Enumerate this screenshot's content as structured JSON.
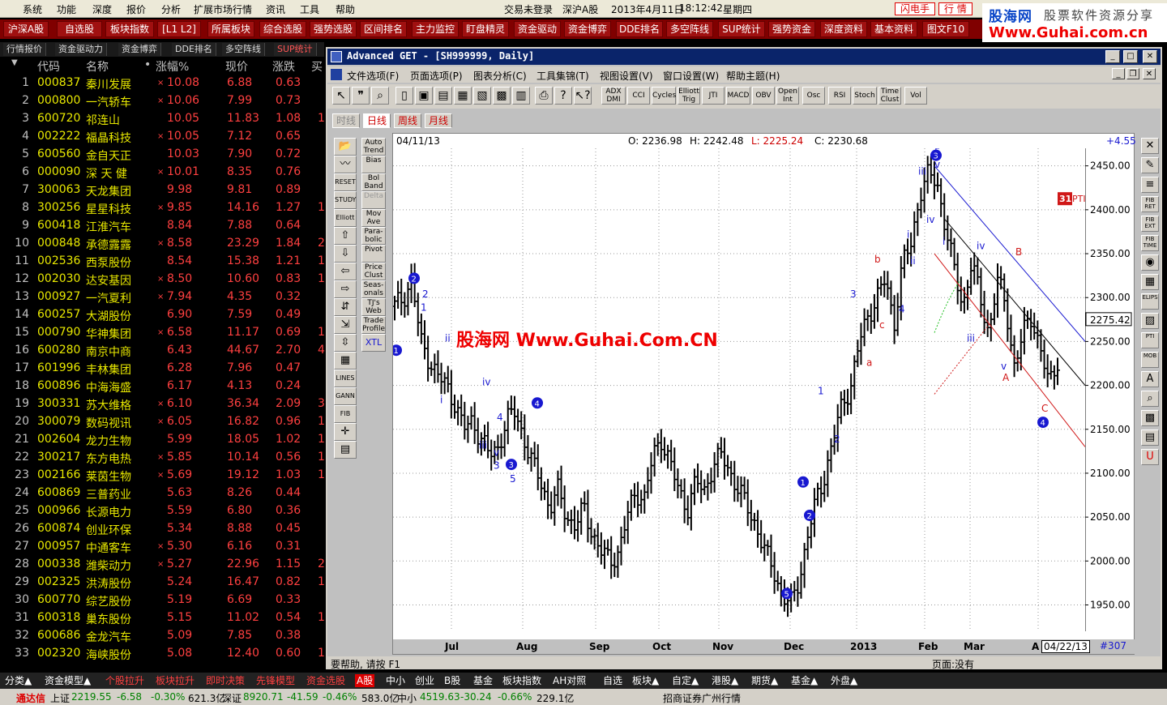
{
  "menu": {
    "items": [
      "系统",
      "功能",
      "深度",
      "报价",
      "分析",
      "扩展市场行情",
      "资讯",
      "工具",
      "帮助"
    ],
    "status": "交易未登录",
    "market": "深沪A股",
    "datetime": "2013年4月11日",
    "time": "18:12:42",
    "weekday": "星期四",
    "flash_btn": "闪电手",
    "quote_btn": "行  情"
  },
  "logo": {
    "line1": "股海网",
    "line1b": "股票软件资源分享",
    "line2": "Www.Guhai.com.cn"
  },
  "toolbar": [
    "沪深A股",
    "自选股",
    "板块指数",
    "[L1 L2]",
    "所属板块",
    "综合选股",
    "强势选股",
    "区间排名",
    "主力监控",
    "盯盘精灵",
    "资金驱动",
    "资金博弈",
    "DDE排名",
    "多空阵线",
    "SUP统计",
    "强势资金",
    "深度资料",
    "基本资料",
    "图文F10"
  ],
  "subtabs": [
    "行情报价",
    "资金驱动力",
    "资金博弈",
    "DDE排名",
    "多空阵线",
    "SUP统计"
  ],
  "quote": {
    "headers": [
      "代码",
      "名称",
      "•",
      "涨幅%",
      "现价",
      "涨跌",
      "买"
    ],
    "rows": [
      {
        "n": "1",
        "code": "000837",
        "name": "秦川发展",
        "mark": "×",
        "pct": "10.08",
        "price": "6.88",
        "chg": "0.63",
        "extra": ""
      },
      {
        "n": "2",
        "code": "000800",
        "name": "一汽轿车",
        "mark": "×",
        "pct": "10.06",
        "price": "7.99",
        "chg": "0.73",
        "extra": ""
      },
      {
        "n": "3",
        "code": "600720",
        "name": "祁连山",
        "mark": "",
        "pct": "10.05",
        "price": "11.83",
        "chg": "1.08",
        "extra": "1"
      },
      {
        "n": "4",
        "code": "002222",
        "name": "福晶科技",
        "mark": "×",
        "pct": "10.05",
        "price": "7.12",
        "chg": "0.65",
        "extra": ""
      },
      {
        "n": "5",
        "code": "600560",
        "name": "金自天正",
        "mark": "",
        "pct": "10.03",
        "price": "7.90",
        "chg": "0.72",
        "extra": ""
      },
      {
        "n": "6",
        "code": "000090",
        "name": "深 天 健",
        "mark": "×",
        "pct": "10.01",
        "price": "8.35",
        "chg": "0.76",
        "extra": ""
      },
      {
        "n": "7",
        "code": "300063",
        "name": "天龙集团",
        "mark": "",
        "pct": "9.98",
        "price": "9.81",
        "chg": "0.89",
        "extra": ""
      },
      {
        "n": "8",
        "code": "300256",
        "name": "星星科技",
        "mark": "×",
        "pct": "9.85",
        "price": "14.16",
        "chg": "1.27",
        "extra": "1"
      },
      {
        "n": "9",
        "code": "600418",
        "name": "江淮汽车",
        "mark": "",
        "pct": "8.84",
        "price": "7.88",
        "chg": "0.64",
        "extra": ""
      },
      {
        "n": "10",
        "code": "000848",
        "name": "承德露露",
        "mark": "×",
        "pct": "8.58",
        "price": "23.29",
        "chg": "1.84",
        "extra": "2"
      },
      {
        "n": "11",
        "code": "002536",
        "name": "西泵股份",
        "mark": "",
        "pct": "8.54",
        "price": "15.38",
        "chg": "1.21",
        "extra": "1"
      },
      {
        "n": "12",
        "code": "002030",
        "name": "达安基因",
        "mark": "×",
        "pct": "8.50",
        "price": "10.60",
        "chg": "0.83",
        "extra": "1"
      },
      {
        "n": "13",
        "code": "000927",
        "name": "一汽夏利",
        "mark": "×",
        "pct": "7.94",
        "price": "4.35",
        "chg": "0.32",
        "extra": ""
      },
      {
        "n": "14",
        "code": "600257",
        "name": "大湖股份",
        "mark": "",
        "pct": "6.90",
        "price": "7.59",
        "chg": "0.49",
        "extra": ""
      },
      {
        "n": "15",
        "code": "000790",
        "name": "华神集团",
        "mark": "×",
        "pct": "6.58",
        "price": "11.17",
        "chg": "0.69",
        "extra": "1"
      },
      {
        "n": "16",
        "code": "600280",
        "name": "南京中商",
        "mark": "",
        "pct": "6.43",
        "price": "44.67",
        "chg": "2.70",
        "extra": "4"
      },
      {
        "n": "17",
        "code": "601996",
        "name": "丰林集团",
        "mark": "",
        "pct": "6.28",
        "price": "7.96",
        "chg": "0.47",
        "extra": ""
      },
      {
        "n": "18",
        "code": "600896",
        "name": "中海海盛",
        "mark": "",
        "pct": "6.17",
        "price": "4.13",
        "chg": "0.24",
        "extra": ""
      },
      {
        "n": "19",
        "code": "300331",
        "name": "苏大维格",
        "mark": "×",
        "pct": "6.10",
        "price": "36.34",
        "chg": "2.09",
        "extra": "3"
      },
      {
        "n": "20",
        "code": "300079",
        "name": "数码视讯",
        "mark": "×",
        "pct": "6.05",
        "price": "16.82",
        "chg": "0.96",
        "extra": "1"
      },
      {
        "n": "21",
        "code": "002604",
        "name": "龙力生物",
        "mark": "",
        "pct": "5.99",
        "price": "18.05",
        "chg": "1.02",
        "extra": "1"
      },
      {
        "n": "22",
        "code": "300217",
        "name": "东方电热",
        "mark": "×",
        "pct": "5.85",
        "price": "10.14",
        "chg": "0.56",
        "extra": "1"
      },
      {
        "n": "23",
        "code": "002166",
        "name": "莱茵生物",
        "mark": "×",
        "pct": "5.69",
        "price": "19.12",
        "chg": "1.03",
        "extra": "1"
      },
      {
        "n": "24",
        "code": "600869",
        "name": "三普药业",
        "mark": "",
        "pct": "5.63",
        "price": "8.26",
        "chg": "0.44",
        "extra": ""
      },
      {
        "n": "25",
        "code": "000966",
        "name": "长源电力",
        "mark": "",
        "pct": "5.59",
        "price": "6.80",
        "chg": "0.36",
        "extra": ""
      },
      {
        "n": "26",
        "code": "600874",
        "name": "创业环保",
        "mark": "",
        "pct": "5.34",
        "price": "8.88",
        "chg": "0.45",
        "extra": ""
      },
      {
        "n": "27",
        "code": "000957",
        "name": "中通客车",
        "mark": "×",
        "pct": "5.30",
        "price": "6.16",
        "chg": "0.31",
        "extra": ""
      },
      {
        "n": "28",
        "code": "000338",
        "name": "潍柴动力",
        "mark": "×",
        "pct": "5.27",
        "price": "22.96",
        "chg": "1.15",
        "extra": "2"
      },
      {
        "n": "29",
        "code": "002325",
        "name": "洪涛股份",
        "mark": "",
        "pct": "5.24",
        "price": "16.47",
        "chg": "0.82",
        "extra": "1"
      },
      {
        "n": "30",
        "code": "600770",
        "name": "综艺股份",
        "mark": "",
        "pct": "5.19",
        "price": "6.69",
        "chg": "0.33",
        "extra": ""
      },
      {
        "n": "31",
        "code": "600318",
        "name": "巢东股份",
        "mark": "",
        "pct": "5.15",
        "price": "11.02",
        "chg": "0.54",
        "extra": "1"
      },
      {
        "n": "32",
        "code": "600686",
        "name": "金龙汽车",
        "mark": "",
        "pct": "5.09",
        "price": "7.85",
        "chg": "0.38",
        "extra": ""
      },
      {
        "n": "33",
        "code": "002320",
        "name": "海峡股份",
        "mark": "",
        "pct": "5.08",
        "price": "12.40",
        "chg": "0.60",
        "extra": "1"
      }
    ]
  },
  "chartwin": {
    "title": "Advanced GET - [SH999999, Daily]",
    "menu": [
      "文件选项(F)",
      "页面选项(P)",
      "图表分析(C)",
      "工具集锦(T)",
      "视图设置(V)",
      "窗口设置(W)",
      "帮助主题(H)"
    ],
    "studies": [
      "ADX DMI",
      "CCI",
      "Cycles",
      "Elliott Trig",
      "JTI",
      "MACD",
      "OBV",
      "Open Int",
      "Osc",
      "RSI",
      "Stoch",
      "Time Clust",
      "Vol"
    ],
    "periods": [
      "时线",
      "日线",
      "周线",
      "月线"
    ],
    "left_tools": [
      "Auto Trend",
      "Bias",
      "Bol Band",
      "Delta",
      "Mov Ave",
      "Para- bolic",
      "Pivot",
      "Price Clust",
      "Seas- onals",
      "TJ's Web",
      "Trade Profile",
      "XTL"
    ],
    "left_icons": [
      "RESET",
      "STUDY",
      "Elliott",
      "LINES",
      "GANN",
      "FIB"
    ],
    "right_tools": [
      "FIB RET",
      "FIB EXT",
      "FIB TIME",
      "ELIPS",
      "PTI",
      "MOB"
    ],
    "date": "04/11/13",
    "ohlc": {
      "o": "O: 2236.98",
      "h": "H: 2242.48",
      "l": "L: 2225.24",
      "c": "C: 2230.68"
    },
    "change": "+4.55",
    "last_price": "2275.42",
    "pti": "31",
    "pti_label": "PTI",
    "end_date": "04/22/13",
    "bar_no": "#307",
    "watermark": "股海网 Www.Guhai.Com.CN",
    "status_left": "要帮助, 请按 F1",
    "status_right": "页面:没有"
  },
  "chart_data": {
    "type": "ohlc",
    "title": "",
    "x_labels": [
      "Jul",
      "Aug",
      "Sep",
      "Oct",
      "Nov",
      "Dec",
      "2013",
      "Feb",
      "Mar",
      "A"
    ],
    "y_ticks": [
      1950,
      2000,
      2050,
      2100,
      2150,
      2200,
      2250,
      2300,
      2350,
      2400,
      2450
    ],
    "ylim": [
      1920,
      2470
    ],
    "close_path": [
      2290,
      2300,
      2320,
      2250,
      2230,
      2210,
      2200,
      2180,
      2150,
      2160,
      2140,
      2120,
      2130,
      2160,
      2170,
      2140,
      2110,
      2090,
      2060,
      2080,
      2050,
      2040,
      2060,
      2030,
      2010,
      2000,
      2010,
      2050,
      2080,
      2070,
      2120,
      2140,
      2110,
      2080,
      2060,
      2090,
      2080,
      2110,
      2120,
      2100,
      2080,
      2060,
      2040,
      2010,
      1990,
      1960,
      1950,
      1980,
      2030,
      2070,
      2100,
      2140,
      2180,
      2200,
      2250,
      2280,
      2300,
      2320,
      2270,
      2340,
      2360,
      2420,
      2440,
      2430,
      2380,
      2330,
      2290,
      2340,
      2300,
      2260,
      2320,
      2290,
      2220,
      2260,
      2280,
      2240,
      2200,
      2230
    ]
  },
  "bottomtabs": [
    "分类▲",
    "资金模型▲",
    "个股拉升",
    "板块拉升",
    "即时决策",
    "先锋模型",
    "资金选股",
    "A股",
    "中小",
    "创业",
    "B股",
    "基金",
    "板块指数",
    "AH对照",
    "自选",
    "板块▲",
    "自定▲",
    "港股▲",
    "期货▲",
    "基金▲",
    "外盘▲"
  ],
  "statusbar": {
    "app": "通达信",
    "sh_label": "上证",
    "sh": "2219.55",
    "sh_chg": "-6.58",
    "sh_pct": "-0.30%",
    "sh_vol": "621.3亿",
    "sz_label": "深证",
    "sz": "8920.71",
    "sz_chg": "-41.59",
    "sz_pct": "-0.46%",
    "sz_vol": "583.0亿",
    "zx_label": "中小",
    "zx": "4519.63",
    "zx_chg": "-30.24",
    "zx_pct": "-0.66%",
    "zx_vol": "229.1亿",
    "broker": "招商证券广州行情"
  }
}
